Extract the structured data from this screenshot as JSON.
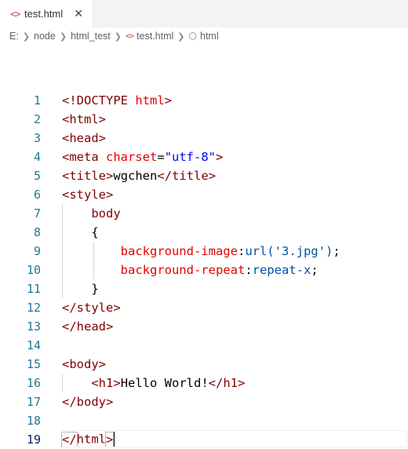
{
  "tab": {
    "icon": "html-file-icon",
    "label": "test.html",
    "close": "✕"
  },
  "breadcrumb": {
    "items": [
      "E:",
      "node",
      "html_test",
      "test.html",
      "html"
    ]
  },
  "editor": {
    "lines": [
      {
        "n": "1"
      },
      {
        "n": "2"
      },
      {
        "n": "3"
      },
      {
        "n": "4"
      },
      {
        "n": "5"
      },
      {
        "n": "6"
      },
      {
        "n": "7"
      },
      {
        "n": "8"
      },
      {
        "n": "9"
      },
      {
        "n": "10"
      },
      {
        "n": "11"
      },
      {
        "n": "12"
      },
      {
        "n": "13"
      },
      {
        "n": "14"
      },
      {
        "n": "15"
      },
      {
        "n": "16"
      },
      {
        "n": "17"
      },
      {
        "n": "18"
      },
      {
        "n": "19"
      }
    ],
    "tokens": {
      "doctype": "<!DOCTYPE",
      "html_kw": "html",
      "gt": ">",
      "lt": "<",
      "lt_slash": "</",
      "html": "html",
      "head": "head",
      "meta": "meta",
      "charset_attr": "charset",
      "eq": "=",
      "utf8": "\"utf-8\"",
      "title": "title",
      "title_text": "wgchen",
      "style": "style",
      "body_sel": "body",
      "open_brace": "{",
      "close_brace": "}",
      "bg_image_prop": "background-image",
      "colon": ":",
      "url_val": "url('3.jpg')",
      "semicolon": ";",
      "bg_repeat_prop": "background-repeat",
      "repeat_val": "repeat-x",
      "body": "body",
      "h1": "h1",
      "h1_text": "Hello World!"
    }
  }
}
